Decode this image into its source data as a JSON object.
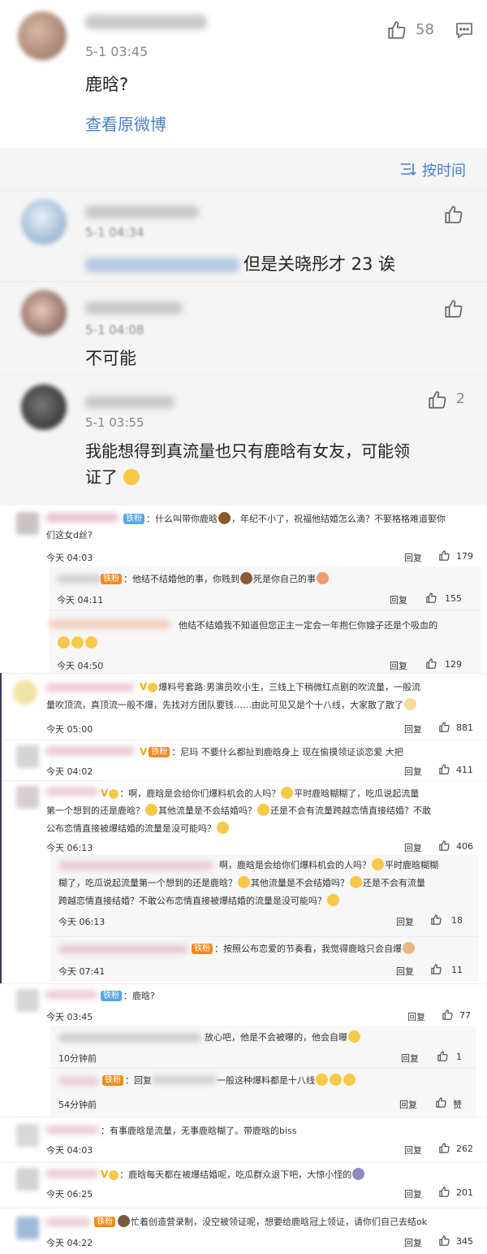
{
  "header": {
    "time": "5-1 03:45",
    "text": "鹿晗?",
    "like_count": "58",
    "view_original": "查看原微博"
  },
  "sort": {
    "label": "按时间"
  },
  "replies": [
    {
      "time": "5-1 04:34",
      "text": "但是关晓彤才 23 诶",
      "likes": ""
    },
    {
      "time": "5-1 04:08",
      "text": "不可能",
      "likes": ""
    },
    {
      "time": "5-1 03:55",
      "text_line1": "我能想得到真流量也只有鹿晗有女友，可能领",
      "text_line2": "证了",
      "likes": "2"
    }
  ],
  "labels": {
    "reply": "回复",
    "badge_iron": "铁粉"
  },
  "comments": {
    "c1": {
      "text1": "：什么叫带你鹿晗",
      "text1b": "，年纪不小了，祝福他结婚怎么滴？不娶格格难道娶你",
      "text2": "们这女d丝?",
      "time": "今天 04:03",
      "likes": "179"
    },
    "c1s1": {
      "text": "：他结不结婚他的事，你贱到",
      "text_b": "死是你自己的事",
      "time": "今天 04:11",
      "likes": "155"
    },
    "c1s2": {
      "text": "他结不结婚我不知道但您正主一定会一年抱仨你嫂子还是个吸血的",
      "time": "今天 04:50",
      "likes": "129"
    },
    "c2": {
      "text1": "爆料号套路:男演员吹小生，三线上下稍微红点剧的吹流量，一般流",
      "text2": "量吹顶流，真顶流一般不爆，先找对方团队要钱……由此可见又是个十八线，大家散了散了",
      "time": "今天 05:00",
      "likes": "881"
    },
    "c3": {
      "text": "：尼玛 不要什么都扯到鹿晗身上 现在偷摸领证谈恋爱 大把",
      "time": "今天 04:02",
      "likes": "411"
    },
    "c4": {
      "text1a": "：啊，鹿晗是会给你们爆料机会的人吗？",
      "text1b": "平时鹿晗糊糊了，吃瓜说起流量",
      "text2a": "第一个想到的还是鹿晗？",
      "text2b": "其他流量是不会结婚吗？",
      "text2c": "还是不会有流量跨越恋情直接结婚？不敢",
      "text3": "公布恋情直接被爆结婚的流量是没可能吗？",
      "time": "今天 06:13",
      "likes": "406"
    },
    "c4s1": {
      "text1a": "啊，鹿晗是会给你们爆料机会的人吗？",
      "text1b": "平时鹿晗糊糊",
      "text2a": "糊了，吃瓜说起流量第一个想到的还是鹿晗？",
      "text2b": "其他流量是不会结婚吗？",
      "text2c": "还是不会有流量",
      "text3": "跨越恋情直接结婚？不敢公布恋情直接被爆结婚的流量是没可能吗？",
      "time": "今天 06:13",
      "likes": "18"
    },
    "c4s2": {
      "text": "：按照公布恋爱的节奏看，我觉得鹿晗只会自爆",
      "time": "今天 07:41",
      "likes": "11"
    },
    "c5": {
      "text": "：鹿晗?",
      "time": "今天 03:45",
      "likes": "77"
    },
    "c5s1": {
      "text": "放心吧，他是不会被曝的，他会自曝",
      "time": "10分钟前",
      "likes": "1"
    },
    "c5s2": {
      "text": "：回复",
      "text_b": "一般这种爆料都是十八线",
      "time": "54分钟前",
      "likes": "赞"
    },
    "c6": {
      "text": "：有事鹿晗是流量，无事鹿晗糊了。带鹿晗的biss",
      "time": "今天 04:03",
      "likes": "262"
    },
    "c7": {
      "text": "：鹿晗每天都在被爆结婚呢，吃瓜群众退下吧，大惊小怪的",
      "time": "今天 06:25",
      "likes": "201"
    },
    "c8": {
      "text": "忙着创造营录制，没空被领证呢，想要给鹿晗冠上领证，请你们自己去结ok",
      "time": "今天 04:22",
      "likes": "345"
    }
  }
}
